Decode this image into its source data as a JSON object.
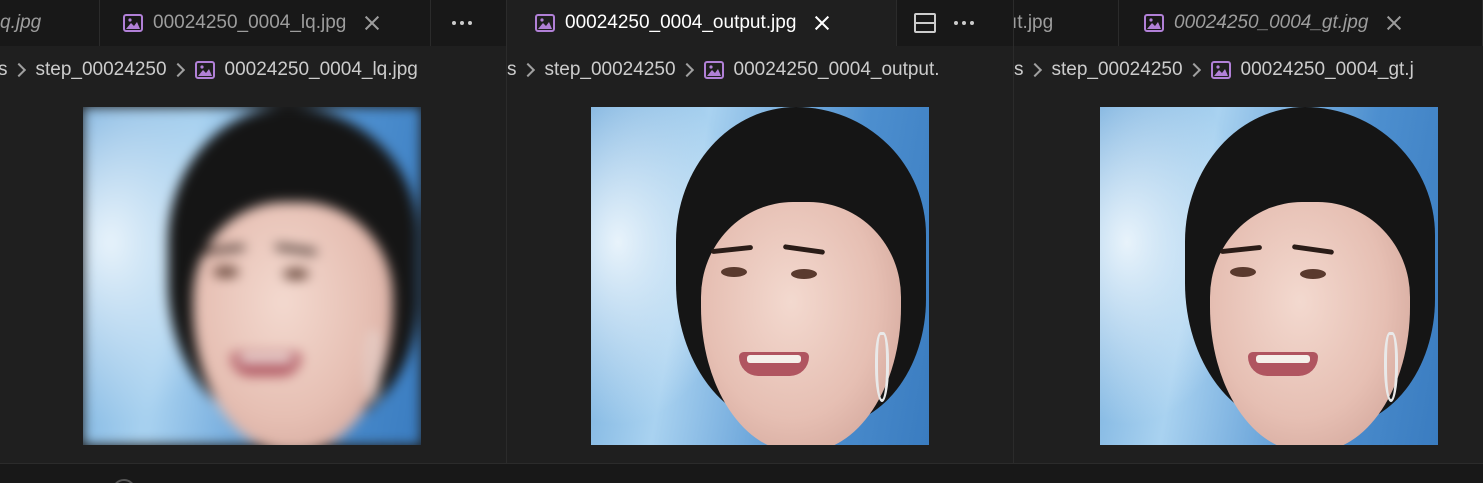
{
  "groups": [
    {
      "tabs": [
        {
          "label": "q.jpg",
          "italic": true,
          "active": false
        },
        {
          "label": "00024250_0004_lq.jpg",
          "italic": false,
          "active": false
        }
      ],
      "breadcrumb": [
        "s",
        "step_00024250",
        "00024250_0004_lq.jpg"
      ]
    },
    {
      "tabs": [
        {
          "label": "00024250_0004_output.jpg",
          "italic": false,
          "active": true
        }
      ],
      "breadcrumb": [
        "s",
        "step_00024250",
        "00024250_0004_output."
      ]
    },
    {
      "tabs": [
        {
          "label": "ıt.jpg",
          "italic": false,
          "active": false
        },
        {
          "label": "00024250_0004_gt.jpg",
          "italic": true,
          "active": false
        }
      ],
      "breadcrumb": [
        "s",
        "step_00024250",
        "00024250_0004_gt.j"
      ]
    }
  ],
  "colors": {
    "editor_bg": "#1f1f1f",
    "tabbar_bg": "#181818",
    "image_icon": "#b180d7",
    "active_text": "#ffffff",
    "inactive_text": "#9d9d9d"
  },
  "icons": {
    "file": "image-file-icon",
    "close": "close-icon",
    "more": "more-actions-icon",
    "split": "split-editor-icon",
    "separator": "chevron-right-icon"
  }
}
